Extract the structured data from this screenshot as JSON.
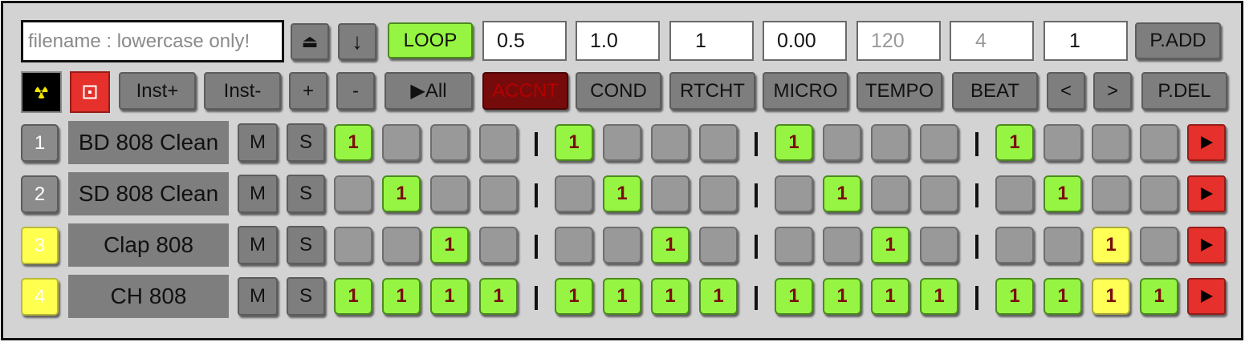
{
  "toolbar": {
    "filename_placeholder": "filename : lowercase only!",
    "eject_glyph": "⏏",
    "download_glyph": "↓",
    "loop_label": "LOOP",
    "fields": [
      "0.5",
      "1.0",
      "1",
      "0.00",
      "120",
      "4",
      "1"
    ],
    "padd_label": "P.ADD"
  },
  "controls": {
    "inst_plus": "Inst+",
    "inst_minus": "Inst-",
    "plus": "+",
    "minus": "-",
    "play_all": "▶All",
    "accent": "ACCNT",
    "cond": "COND",
    "rtcht": "RTCHT",
    "micro": "MICRO",
    "tempo": "TEMPO",
    "beat": "BEAT",
    "prev": "<",
    "next": ">",
    "pdel": "P.DEL"
  },
  "tracks": [
    {
      "number": "1",
      "name": "BD 808 Clean",
      "mute": "M",
      "solo": "S",
      "selected": false,
      "steps": [
        "1",
        "",
        "",
        "",
        "1",
        "",
        "",
        "",
        "1",
        "",
        "",
        "",
        "1",
        "",
        "",
        ""
      ],
      "accent": [
        false,
        false,
        false,
        false,
        false,
        false,
        false,
        false,
        false,
        false,
        false,
        false,
        false,
        false,
        false,
        false
      ]
    },
    {
      "number": "2",
      "name": "SD 808 Clean",
      "mute": "M",
      "solo": "S",
      "selected": false,
      "steps": [
        "",
        "1",
        "",
        "",
        "",
        "1",
        "",
        "",
        "",
        "1",
        "",
        "",
        "",
        "1",
        "",
        ""
      ],
      "accent": [
        false,
        false,
        false,
        false,
        false,
        false,
        false,
        false,
        false,
        false,
        false,
        false,
        false,
        false,
        false,
        false
      ]
    },
    {
      "number": "3",
      "name": "Clap 808",
      "mute": "M",
      "solo": "S",
      "selected": true,
      "steps": [
        "",
        "",
        "1",
        "",
        "",
        "",
        "1",
        "",
        "",
        "",
        "1",
        "",
        "",
        "",
        "1",
        ""
      ],
      "accent": [
        false,
        false,
        false,
        false,
        false,
        false,
        false,
        false,
        false,
        false,
        false,
        false,
        false,
        false,
        true,
        false
      ]
    },
    {
      "number": "4",
      "name": "CH 808",
      "mute": "M",
      "solo": "S",
      "selected": true,
      "steps": [
        "1",
        "1",
        "1",
        "1",
        "1",
        "1",
        "1",
        "1",
        "1",
        "1",
        "1",
        "1",
        "1",
        "1",
        "1",
        "1"
      ],
      "accent": [
        false,
        false,
        false,
        false,
        false,
        false,
        false,
        false,
        false,
        false,
        false,
        false,
        false,
        false,
        true,
        false
      ]
    }
  ],
  "colors": {
    "step_on": "#96f542",
    "step_accent": "#ffff55",
    "accent_button": "#760b0b",
    "play_row": "#e5302b",
    "selected_track": "#ffff4f"
  }
}
